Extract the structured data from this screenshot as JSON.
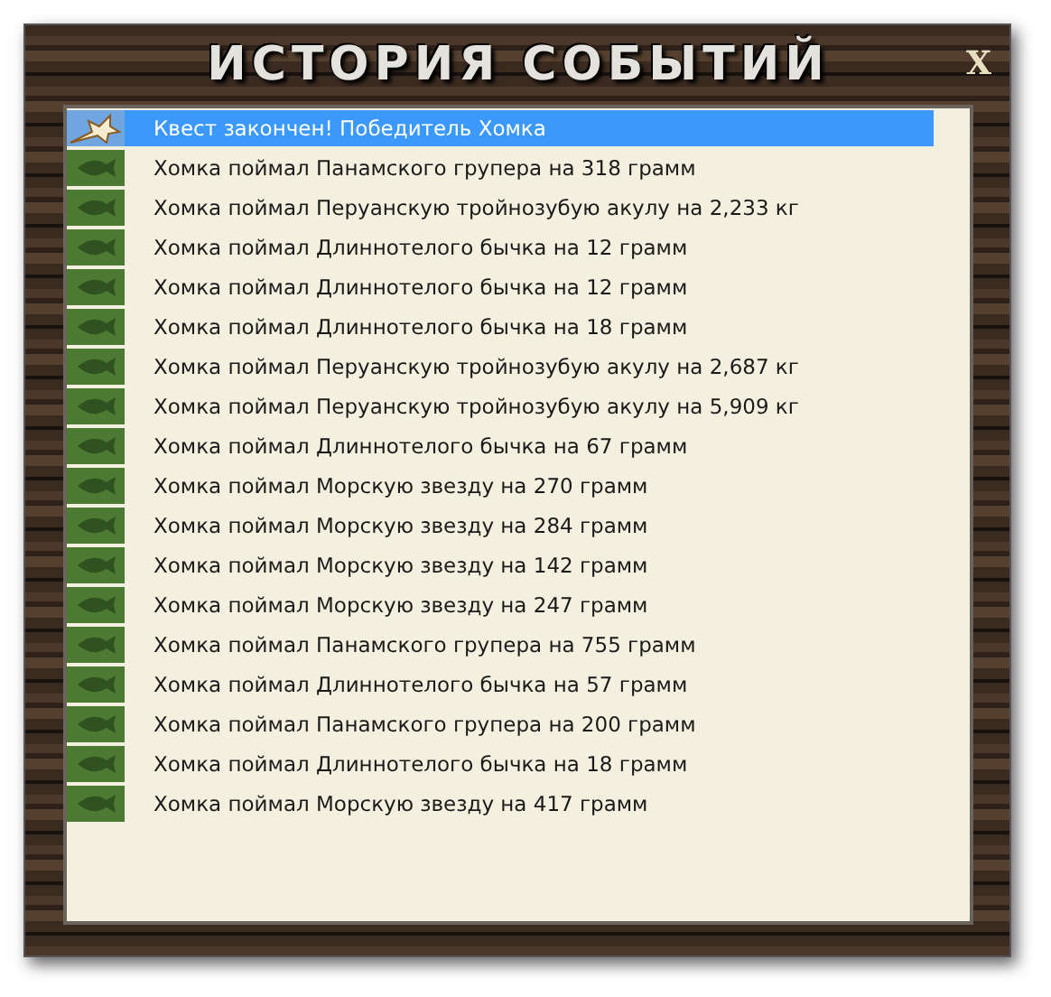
{
  "window": {
    "title": "ИСТОРИЯ СОБЫТИЙ",
    "close": "X"
  },
  "events": [
    {
      "kind": "quest",
      "text": "Квест закончен! Победитель Хомка",
      "selected": true
    },
    {
      "kind": "fish",
      "text": "Хомка поймал Панамского групера на 318 грамм",
      "selected": false
    },
    {
      "kind": "fish",
      "text": "Хомка поймал Перуанскую тройнозубую акулу на 2,233 кг",
      "selected": false
    },
    {
      "kind": "fish",
      "text": "Хомка поймал Длиннотелого бычка на 12 грамм",
      "selected": false
    },
    {
      "kind": "fish",
      "text": "Хомка поймал Длиннотелого бычка на 12 грамм",
      "selected": false
    },
    {
      "kind": "fish",
      "text": "Хомка поймал Длиннотелого бычка на 18 грамм",
      "selected": false
    },
    {
      "kind": "fish",
      "text": "Хомка поймал Перуанскую тройнозубую акулу на 2,687 кг",
      "selected": false
    },
    {
      "kind": "fish",
      "text": "Хомка поймал Перуанскую тройнозубую акулу на 5,909 кг",
      "selected": false
    },
    {
      "kind": "fish",
      "text": "Хомка поймал Длиннотелого бычка на 67 грамм",
      "selected": false
    },
    {
      "kind": "fish",
      "text": "Хомка поймал Морскую звезду на 270 грамм",
      "selected": false
    },
    {
      "kind": "fish",
      "text": "Хомка поймал Морскую звезду на 284 грамм",
      "selected": false
    },
    {
      "kind": "fish",
      "text": "Хомка поймал Морскую звезду на 142 грамм",
      "selected": false
    },
    {
      "kind": "fish",
      "text": "Хомка поймал Морскую звезду на 247 грамм",
      "selected": false
    },
    {
      "kind": "fish",
      "text": "Хомка поймал Панамского групера на 755 грамм",
      "selected": false
    },
    {
      "kind": "fish",
      "text": "Хомка поймал Длиннотелого бычка на 57 грамм",
      "selected": false
    },
    {
      "kind": "fish",
      "text": "Хомка поймал Панамского групера на 200 грамм",
      "selected": false
    },
    {
      "kind": "fish",
      "text": "Хомка поймал Длиннотелого бычка на 18 грамм",
      "selected": false
    },
    {
      "kind": "fish",
      "text": "Хомка поймал Морскую звезду на 417 грамм",
      "selected": false
    }
  ]
}
